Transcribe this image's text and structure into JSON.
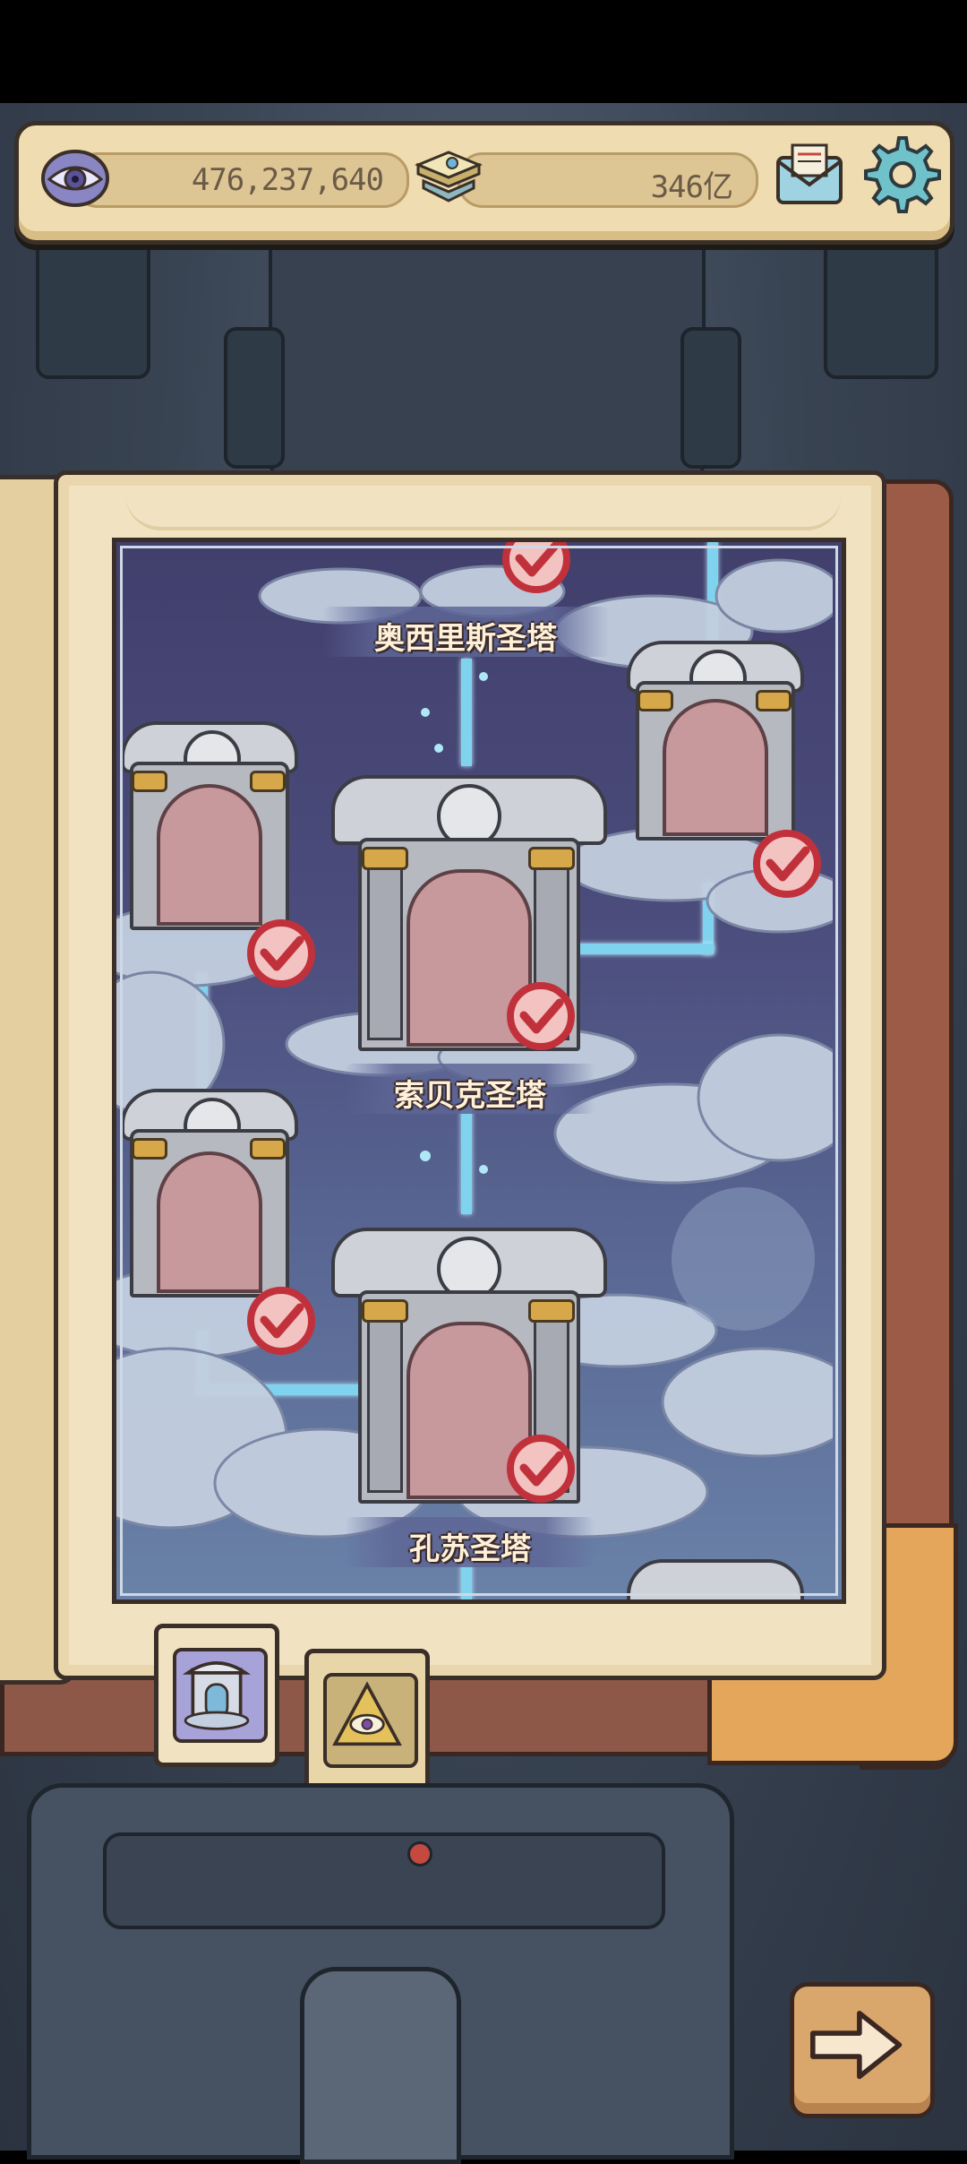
{
  "currencies": {
    "eye_value": "476,237,640",
    "ore_value": "346亿"
  },
  "icons": {
    "eye": "eye-icon",
    "ore": "ore-stack-icon",
    "mail": "mail-icon",
    "settings": "gear-icon",
    "next": "arrow-right-icon"
  },
  "towers": [
    {
      "label": "奥西里斯圣塔",
      "completed": true
    },
    {
      "label": "索贝克圣塔",
      "completed": true
    },
    {
      "label": "孔苏圣塔",
      "completed": true
    }
  ],
  "side_shrines": [
    {
      "completed": true
    },
    {
      "completed": true
    },
    {
      "completed": true
    }
  ],
  "book_tabs": [
    {
      "name": "shrine-tab",
      "active": true
    },
    {
      "name": "eye-pyramid-tab",
      "active": false
    }
  ],
  "colors": {
    "accent_connector": "#7fd3ee",
    "check_red": "#d8424a",
    "panel_cream": "#efdcb0"
  }
}
